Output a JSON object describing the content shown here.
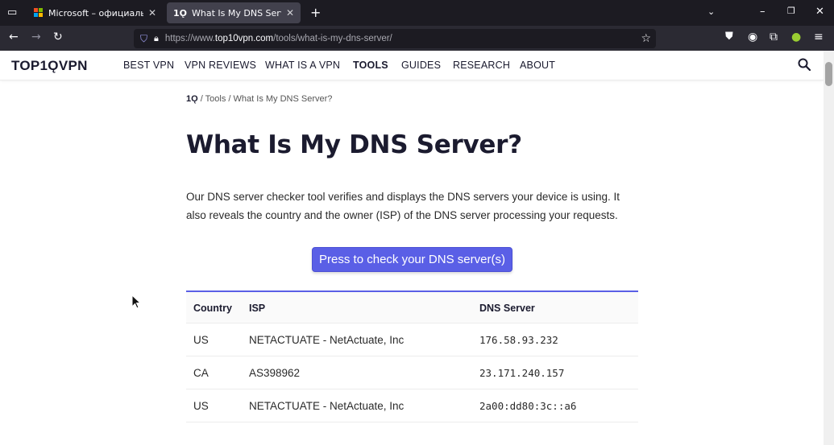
{
  "browser": {
    "tabs": [
      {
        "title": "Microsoft – официальная домашняя",
        "active": false
      },
      {
        "title": "What Is My DNS Server? Check",
        "favicon": "1Ǫ",
        "active": true
      }
    ],
    "new_tab": "+",
    "url_prefix": "https://www.",
    "url_domain": "top10vpn.com",
    "url_path": "/tools/what-is-my-dns-server/",
    "colors": {
      "tabbar": "#1c1b22",
      "active_tab": "#42414d",
      "navbar": "#2b2a33"
    }
  },
  "site": {
    "logo": "TOP1ǪVPN",
    "menu": [
      "BEST VPN",
      "VPN REVIEWS",
      "WHAT IS A VPN",
      "TOOLS",
      "GUIDES",
      "RESEARCH",
      "ABOUT"
    ],
    "active_menu": "TOOLS",
    "accent_color": "#5a5fe6"
  },
  "breadcrumb": {
    "home": "1Ǫ",
    "sep1": " / ",
    "tools": "Tools",
    "sep2": " / ",
    "current": "What Is My DNS Server?"
  },
  "page": {
    "title": "What Is My DNS Server?",
    "intro": "Our DNS server checker tool verifies and displays the DNS servers your device is using. It also reveals the country and the owner (ISP) of the DNS server processing your requests.",
    "check_button": "Press to check your DNS server(s)"
  },
  "table": {
    "headers": [
      "Country",
      "ISP",
      "DNS Server"
    ],
    "rows": [
      [
        "US",
        "NETACTUATE - NetActuate, Inc",
        "176.58.93.232"
      ],
      [
        "CA",
        "AS398962",
        "23.171.240.157"
      ],
      [
        "US",
        "NETACTUATE - NetActuate, Inc",
        "2a00:dd80:3c::a6"
      ]
    ]
  }
}
